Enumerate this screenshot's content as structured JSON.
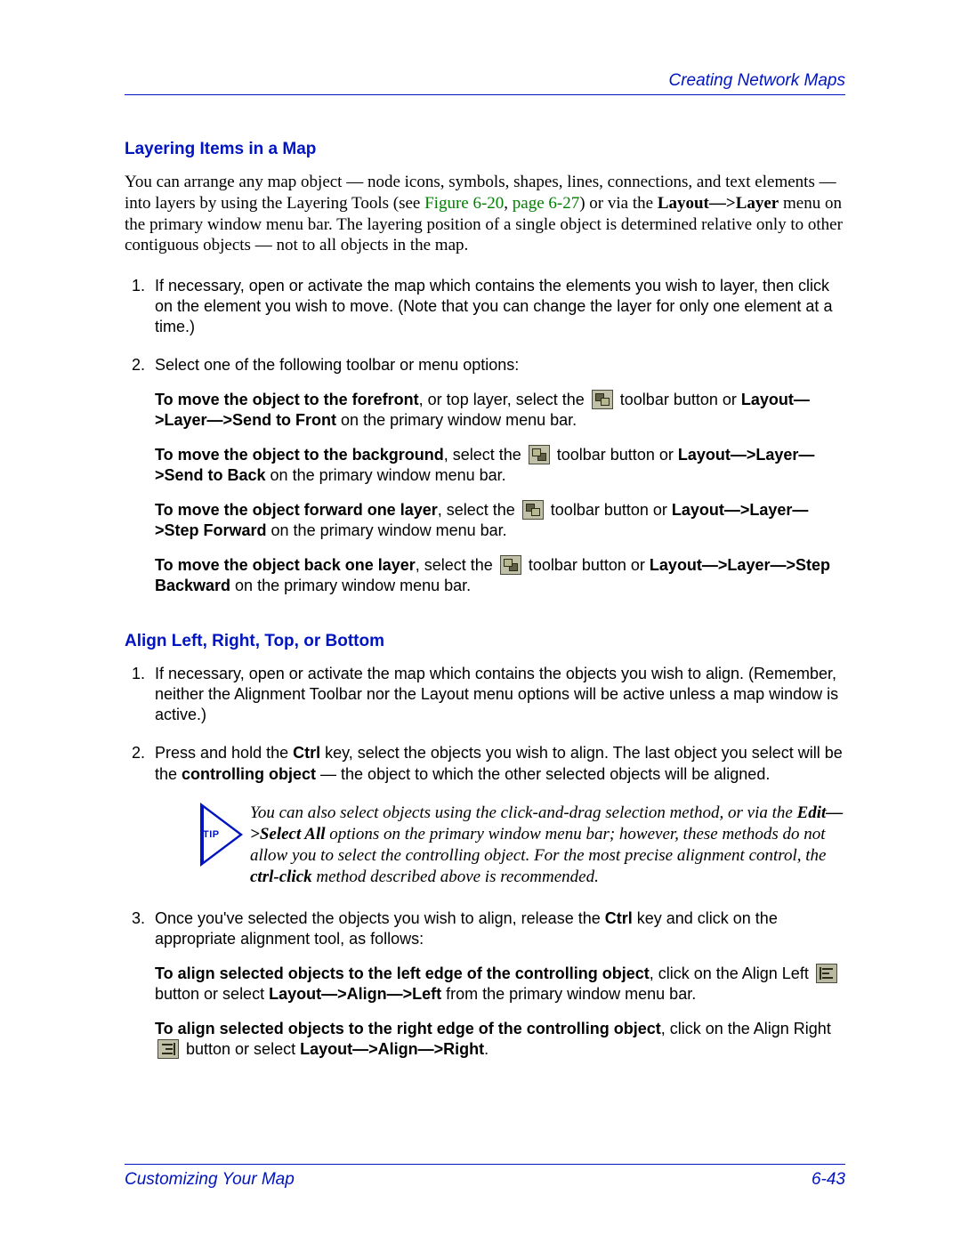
{
  "header": {
    "right": "Creating Network Maps"
  },
  "sections": {
    "layering": {
      "title": "Layering Items in a Map",
      "intro_pre": "You can arrange any map object — node icons, symbols, shapes, lines, connections, and text elements — into layers by using the Layering Tools (see ",
      "intro_link1": "Figure 6-20",
      "intro_sep": ", ",
      "intro_link2": "page 6-27",
      "intro_post_a": ") or via the ",
      "intro_bold": "Layout—>Layer",
      "intro_post_b": " menu on the primary window menu bar. The layering position of a single object is determined relative only to other contiguous objects — not to all objects in the map.",
      "step1": "If necessary, open or activate the map which contains the elements you wish to layer, then click on the element you wish to move. (Note that you can change the layer for only one element at a time.)",
      "step2": "Select one of the following toolbar or menu options:",
      "front_b": "To move the object to the forefront",
      "front_a": ", or top layer, select the ",
      "front_c": " toolbar button or ",
      "front_menu": "Layout—>Layer—>Send to Front",
      "front_d": " on the primary window menu bar.",
      "back_b": "To move the object to the background",
      "back_a": ", select the ",
      "back_c": " toolbar button or ",
      "back_menu": "Layout—>Layer—>Send to Back",
      "back_d": " on the primary window menu bar.",
      "fwd_b": "To move the object forward one layer",
      "fwd_a": ", select the ",
      "fwd_c": " toolbar button or ",
      "fwd_menu": "Layout—>Layer—>Step Forward",
      "fwd_d": " on the primary window menu bar.",
      "bwd_b": "To move the object back one layer",
      "bwd_a": ", select the ",
      "bwd_c": " toolbar button or ",
      "bwd_menu": "Layout—>Layer—>Step Backward",
      "bwd_d": " on the primary window menu bar."
    },
    "align": {
      "title": "Align Left, Right, Top, or Bottom",
      "step1": "If necessary, open or activate the map which contains the objects you wish to align. (Remember, neither the Alignment Toolbar nor the Layout menu options will be active unless a map window is active.)",
      "s2_a": "Press and hold the ",
      "s2_ctrl": "Ctrl",
      "s2_b": " key, select the objects you wish to align. The last object you select will be the ",
      "s2_ctrlobj": "controlling object",
      "s2_c": " — the object to which the other selected objects will be aligned.",
      "tip_label": "TIP",
      "tip_a": "You can also select objects using the click-and-drag selection method, or via the ",
      "tip_menu": "Edit—>Select All",
      "tip_b": " options on the primary window menu bar; however, these methods do not allow you to select the controlling object. For the most precise alignment control, the ",
      "tip_cc": "ctrl-click",
      "tip_c": " method described above is recommended.",
      "s3_a": "Once you've selected the objects you wish to align, release the ",
      "s3_ctrl": "Ctrl",
      "s3_b": " key and click on the appropriate alignment tool, as follows:",
      "left_b": "To align selected objects to the left edge of the controlling object",
      "left_a": ", click on the Align Left ",
      "left_c": " button or select ",
      "left_menu": "Layout—>Align—>Left",
      "left_d": " from the primary window menu bar.",
      "right_b": "To align selected objects to the right edge of the controlling object",
      "right_a": ", click on the Align Right ",
      "right_c": " button or select ",
      "right_menu": "Layout—>Align—>Right",
      "right_d": "."
    }
  },
  "footer": {
    "left": "Customizing Your Map",
    "right": "6-43"
  }
}
